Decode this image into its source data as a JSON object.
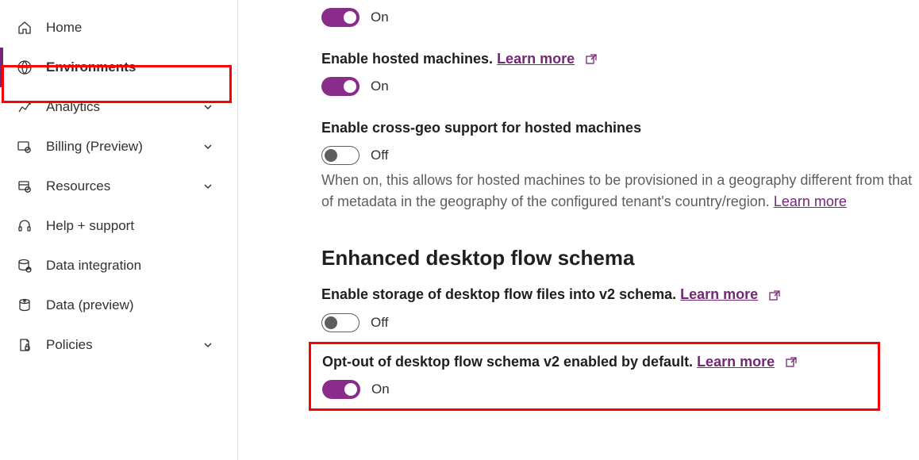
{
  "sidebar": {
    "items": [
      {
        "label": "Home"
      },
      {
        "label": "Environments"
      },
      {
        "label": "Analytics"
      },
      {
        "label": "Billing (Preview)"
      },
      {
        "label": "Resources"
      },
      {
        "label": "Help + support"
      },
      {
        "label": "Data integration"
      },
      {
        "label": "Data (preview)"
      },
      {
        "label": "Policies"
      }
    ]
  },
  "settings": {
    "item0": {
      "state": "On"
    },
    "item1": {
      "label_prefix": "Enable hosted machines. ",
      "learn_more": "Learn more",
      "state": "On"
    },
    "item2": {
      "label": "Enable cross-geo support for hosted machines",
      "state": "Off",
      "desc_prefix": "When on, this allows for hosted machines to be provisioned in a geography different from that of metadata in the geography of the configured tenant's country/region. ",
      "learn_more": "Learn more"
    },
    "section_heading": "Enhanced desktop flow schema",
    "item3": {
      "label_prefix": "Enable storage of desktop flow files into v2 schema. ",
      "learn_more": "Learn more",
      "state": "Off"
    },
    "item4": {
      "label_prefix": "Opt-out of desktop flow schema v2 enabled by default. ",
      "learn_more": "Learn more",
      "state": "On"
    }
  }
}
